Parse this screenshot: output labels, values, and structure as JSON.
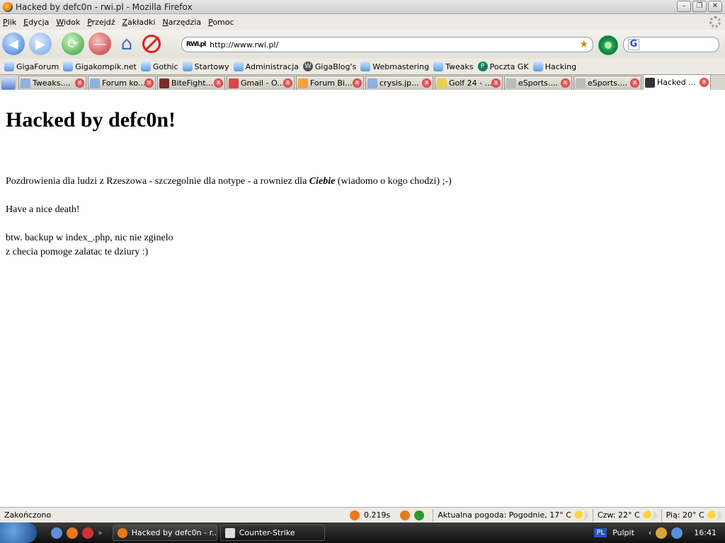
{
  "window": {
    "title": "Hacked by defc0n - rwi.pl - Mozilla Firefox"
  },
  "menu": [
    "Plik",
    "Edycja",
    "Widok",
    "Przejdź",
    "Zakładki",
    "Narzędzia",
    "Pomoc"
  ],
  "nav": {
    "url": "http://www.rwi.pl/",
    "site_icon_text": "RWI.pl",
    "search_value": ""
  },
  "bookmarks": [
    "GigaForum",
    "Gigakompik.net",
    "Gothic",
    "Startowy",
    "Administracja",
    "GigaBlog's",
    "Webmastering",
    "Tweaks",
    "Poczta GK",
    "Hacking"
  ],
  "tabs": [
    {
      "label": "Tweaks...."
    },
    {
      "label": "Forum ko..."
    },
    {
      "label": "BiteFight..."
    },
    {
      "label": "Gmail - O..."
    },
    {
      "label": "Forum Bi..."
    },
    {
      "label": "crysis.jp..."
    },
    {
      "label": "Golf 24 - ..."
    },
    {
      "label": "eSports...."
    },
    {
      "label": "eSports...."
    },
    {
      "label": "Hacked ..."
    }
  ],
  "page": {
    "heading": "Hacked by defc0n!",
    "line1_before": "Pozdrowienia dla ludzi z Rzeszowa - szczegolnie dla notype - a rowniez dla ",
    "line1_emph": "Ciebie",
    "line1_after": " (wiadomo o kogo chodzi) ;-)",
    "line2": "Have a nice death!",
    "line3": "btw. backup w index_.php, nic nie zginelo",
    "line4": "z checia pomoge zalatac te dziury :)"
  },
  "status": {
    "text": "Zakończono",
    "load_time": "0.219s",
    "weather_now": "Aktualna pogoda: Pogodnie, 17° C",
    "weather_thu": "Czw: 22° C",
    "weather_fri": "Pią: 20° C"
  },
  "taskbar": {
    "tasks": [
      "Hacked by defc0n - r...",
      "Counter-Strike"
    ],
    "lang": "PL",
    "desktop": "Pulpit",
    "clock": "16:41"
  }
}
